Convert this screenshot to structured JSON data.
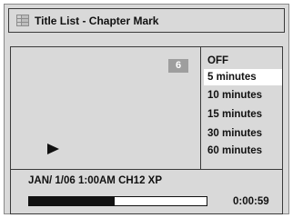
{
  "window": {
    "title": "Title List - Chapter Mark"
  },
  "title_icon": "title-list-icon",
  "preview": {
    "chapter_number": "6",
    "play_icon": "play-icon"
  },
  "menu": {
    "items": [
      {
        "label": "OFF",
        "selected": false
      },
      {
        "label": "5 minutes",
        "selected": true
      },
      {
        "label": "10 minutes",
        "selected": false
      },
      {
        "label": "15 minutes",
        "selected": false
      },
      {
        "label": "30 minutes",
        "selected": false
      },
      {
        "label": "60 minutes",
        "selected": false
      }
    ]
  },
  "status": {
    "recording_info": "JAN/ 1/06 1:00AM CH12 XP"
  },
  "progress": {
    "fraction": 0.48,
    "time": "0:00:59"
  },
  "colors": {
    "background": "#d9d9d9",
    "selected": "#ffffff",
    "badge": "#9e9e9e",
    "text": "#111111"
  }
}
